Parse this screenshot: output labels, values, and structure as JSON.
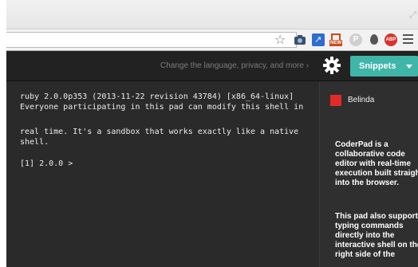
{
  "browser": {
    "resize_glyph": "⤢",
    "star_icon": "☆",
    "extensions": [
      "camera-icon",
      "share-arrow-icon",
      "new-screenshot-icon",
      "pinterest-icon",
      "drop-icon",
      "adblock-icon"
    ],
    "new_badge": "NEW",
    "abp_label": "ABP",
    "p_label": "P"
  },
  "header": {
    "change_link": "Change the language, privacy, and more ›",
    "gear_icon": "gear-icon",
    "snippets_label": "Snippets",
    "accent_color": "#3fb6a8"
  },
  "shell": {
    "lines": [
      "ruby 2.0.0p353 (2013-11-22 revision 43784) [x86_64-linux]",
      "Everyone participating in this pad can modify this shell in",
      "",
      "real time. It's a sandbox that works exactly like a native",
      "shell.",
      "",
      "[1] 2.0.0 >"
    ]
  },
  "sidebar": {
    "user": {
      "name": "Belinda",
      "color": "#e22b26"
    },
    "para1": "CoderPad is a collaborative code editor with real-time execution built straight into the browser.",
    "para2": "This pad also supports typing commands directly into the interactive shell on the right side of the"
  }
}
